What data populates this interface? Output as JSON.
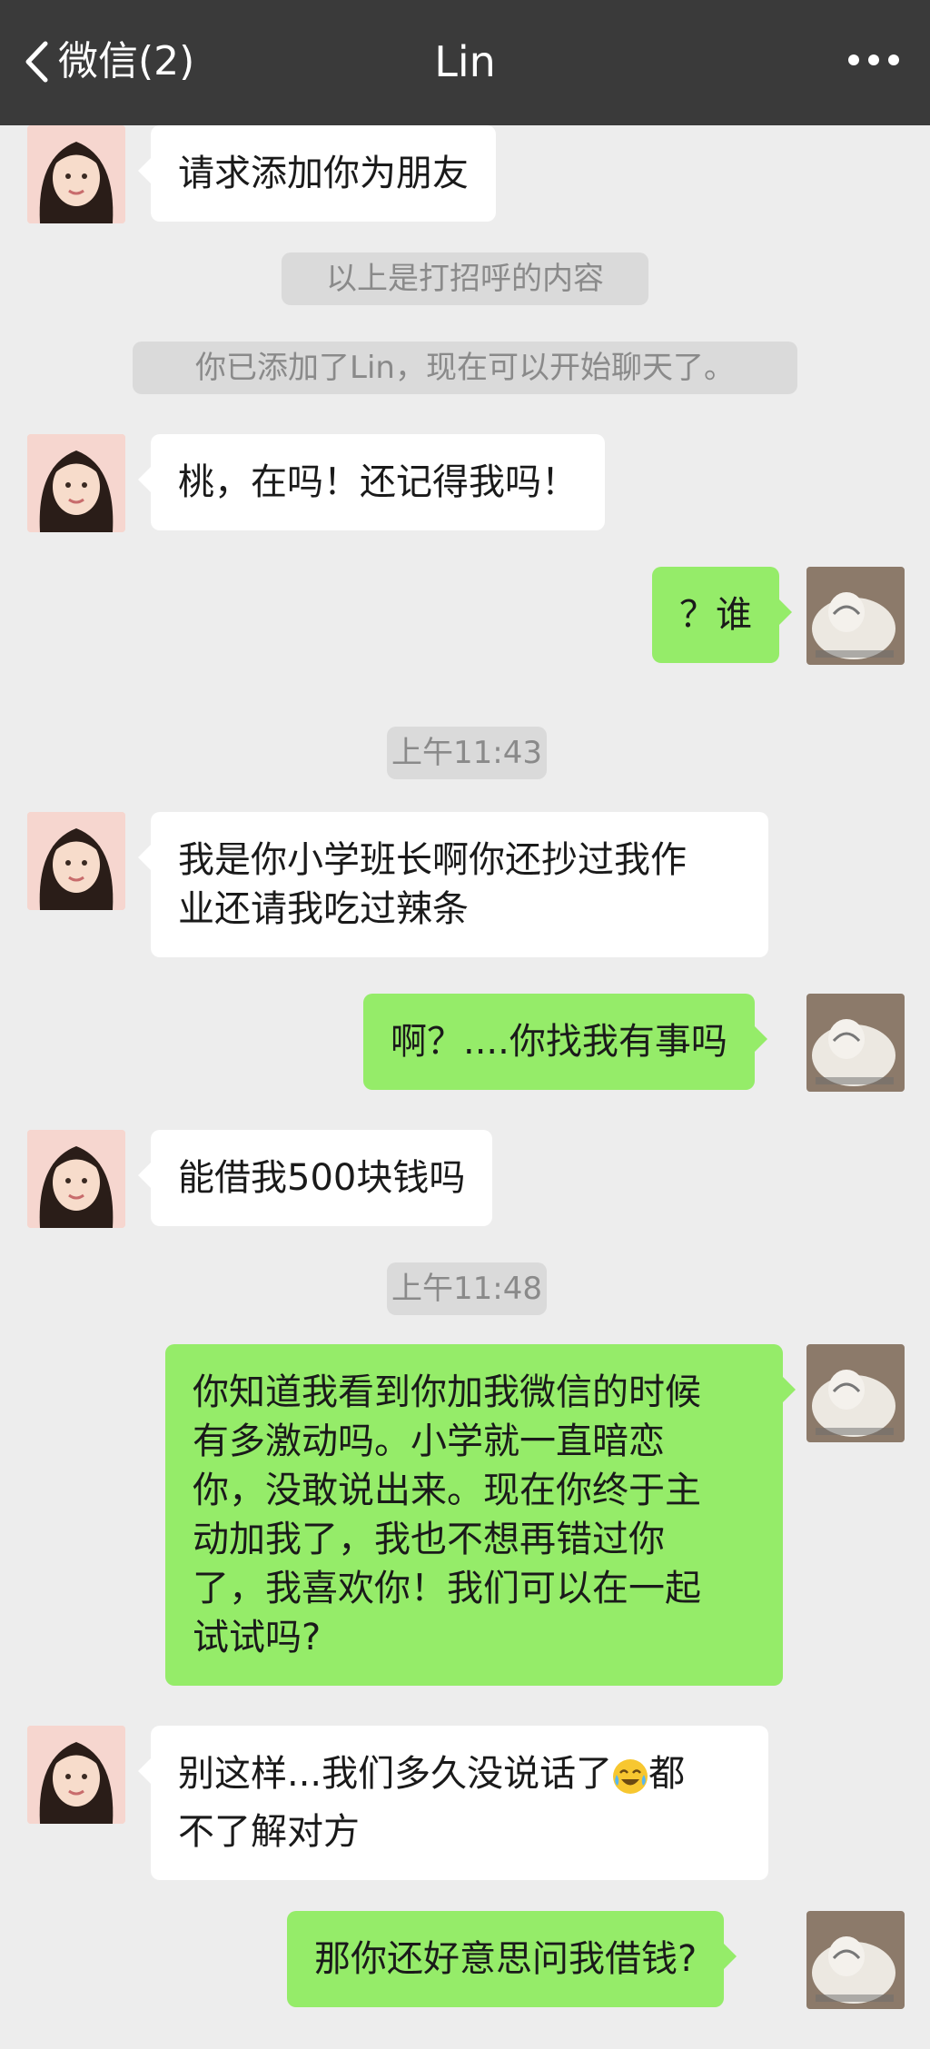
{
  "header": {
    "back_label": "微信(2)",
    "title": "Lin"
  },
  "messages": [
    {
      "sender": "Lin",
      "text": "请求添加你为朋友"
    },
    {
      "type": "system",
      "text": "以上是打招呼的内容"
    },
    {
      "type": "system",
      "text": "你已添加了Lin，现在可以开始聊天了。"
    },
    {
      "sender": "Lin",
      "text": "桃，在吗！还记得我吗！"
    },
    {
      "sender": "me",
      "text": "？谁"
    },
    {
      "type": "time",
      "text": "上午11:43"
    },
    {
      "sender": "Lin",
      "lines": [
        "我是你小学班长啊你还抄过我作",
        "业还请我吃过辣条"
      ]
    },
    {
      "sender": "me",
      "text": "啊？....你找我有事吗"
    },
    {
      "sender": "Lin",
      "text": "能借我500块钱吗"
    },
    {
      "type": "time",
      "text": "上午11:48"
    },
    {
      "sender": "me",
      "lines": [
        "你知道我看到你加我微信的时候",
        "有多激动吗。小学就一直暗恋",
        "你，没敢说出来。现在你终于主",
        "动加我了，我也不想再错过你",
        "了，我喜欢你！我们可以在一起",
        "试试吗?"
      ]
    },
    {
      "sender": "Lin",
      "line1_before_emoji": "别这样...我们多久没说话了",
      "emoji": "crying-laughing-emoji",
      "line1_after_emoji": "都",
      "line2": "不了解对方"
    },
    {
      "sender": "me",
      "text": "那你还好意思问我借钱?"
    }
  ],
  "colors": {
    "header_bg": "#3a3a3a",
    "chat_bg": "#ededed",
    "incoming_bubble": "#ffffff",
    "outgoing_bubble": "#95ec69",
    "system_pill": "#dadada"
  }
}
